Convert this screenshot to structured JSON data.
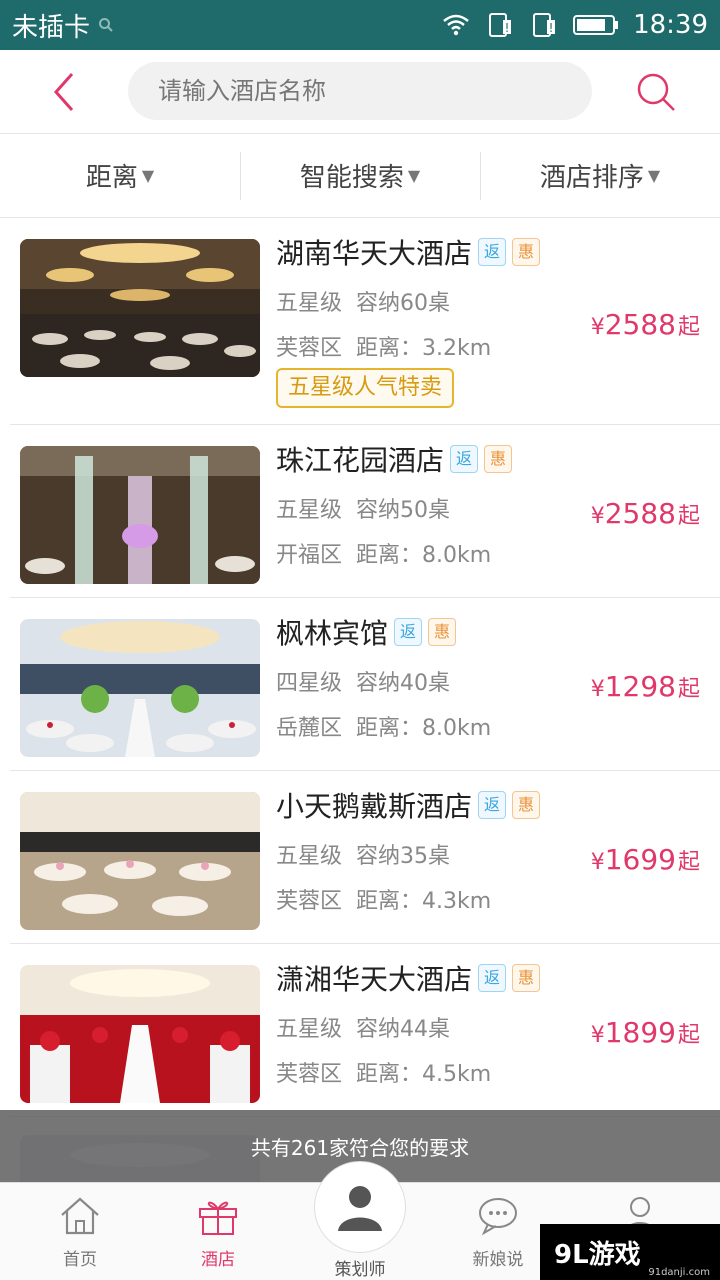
{
  "status_bar": {
    "carrier": "未插卡",
    "time": "18:39"
  },
  "search": {
    "placeholder": "请输入酒店名称"
  },
  "filters": [
    {
      "label": "距离"
    },
    {
      "label": "智能搜索"
    },
    {
      "label": "酒店排序"
    }
  ],
  "hotels": [
    {
      "name": "湖南华天大酒店",
      "tag_fan": "返",
      "tag_hui": "惠",
      "grade": "五星级",
      "capacity": "容纳60桌",
      "district": "芙蓉区",
      "distance": "距离：3.2km",
      "price": "2588",
      "yen": "¥",
      "qi": "起",
      "promo": "五星级人气特卖"
    },
    {
      "name": "珠江花园酒店",
      "tag_fan": "返",
      "tag_hui": "惠",
      "grade": "五星级",
      "capacity": "容纳50桌",
      "district": "开福区",
      "distance": "距离：8.0km",
      "price": "2588",
      "yen": "¥",
      "qi": "起"
    },
    {
      "name": "枫林宾馆",
      "tag_fan": "返",
      "tag_hui": "惠",
      "grade": "四星级",
      "capacity": "容纳40桌",
      "district": "岳麓区",
      "distance": "距离：8.0km",
      "price": "1298",
      "yen": "¥",
      "qi": "起"
    },
    {
      "name": "小天鹅戴斯酒店",
      "tag_fan": "返",
      "tag_hui": "惠",
      "grade": "五星级",
      "capacity": "容纳35桌",
      "district": "芙蓉区",
      "distance": "距离：4.3km",
      "price": "1699",
      "yen": "¥",
      "qi": "起"
    },
    {
      "name": "潇湘华天大酒店",
      "tag_fan": "返",
      "tag_hui": "惠",
      "grade": "五星级",
      "capacity": "容纳44桌",
      "district": "芙蓉区",
      "distance": "距离：4.5km",
      "price": "1899",
      "yen": "¥",
      "qi": "起"
    }
  ],
  "toast": "共有261家符合您的要求",
  "nav": {
    "home": "首页",
    "hotel": "酒店",
    "planner": "策划师",
    "bride": "新娘说",
    "me": ""
  },
  "watermark": {
    "main": "9L游戏",
    "sub": "91danji.com"
  },
  "colors": {
    "status_bar": "#1f6b6b",
    "accent": "#e0386a",
    "promo": "#d79a10"
  }
}
